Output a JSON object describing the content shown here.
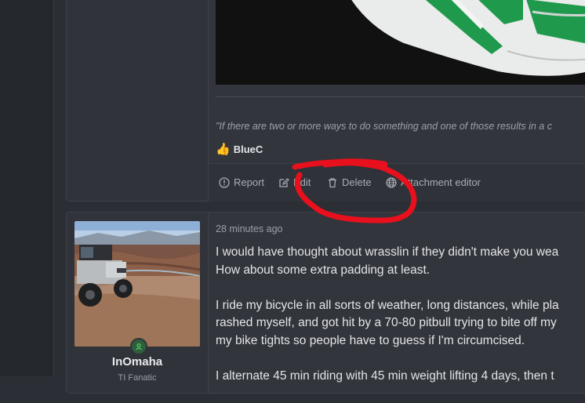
{
  "post1": {
    "signature": "\"If there are two or more ways to do something and one of those results in a c",
    "reaction": {
      "icon": "thumbs-up-icon",
      "user": "BlueC"
    },
    "actions": [
      {
        "label": "Report",
        "icon": "report-icon"
      },
      {
        "label": "Edit",
        "icon": "edit-icon"
      },
      {
        "label": "Delete",
        "icon": "delete-icon"
      },
      {
        "label": "Attachment editor",
        "icon": "globe-icon"
      }
    ]
  },
  "post2": {
    "username": "InOmaha",
    "user_title": "TI Fanatic",
    "timestamp": "28 minutes ago",
    "paragraphs": [
      [
        "I would have thought about wrasslin if they didn't make you wea",
        "How about some extra padding at least."
      ],
      [
        "I ride my bicycle in all sorts of weather, long distances, while pla",
        "rashed myself, and got hit by a 70-80 pitbull trying to bite off my",
        "my bike tights so people have to guess if I'm circumcised."
      ],
      [
        "I alternate 45 min riding with 45 min weight lifting 4 days, then t"
      ]
    ]
  },
  "colors": {
    "annotation": "#e8101c",
    "jersey_green": "#1f9a4c",
    "online": "#3bb15a"
  }
}
